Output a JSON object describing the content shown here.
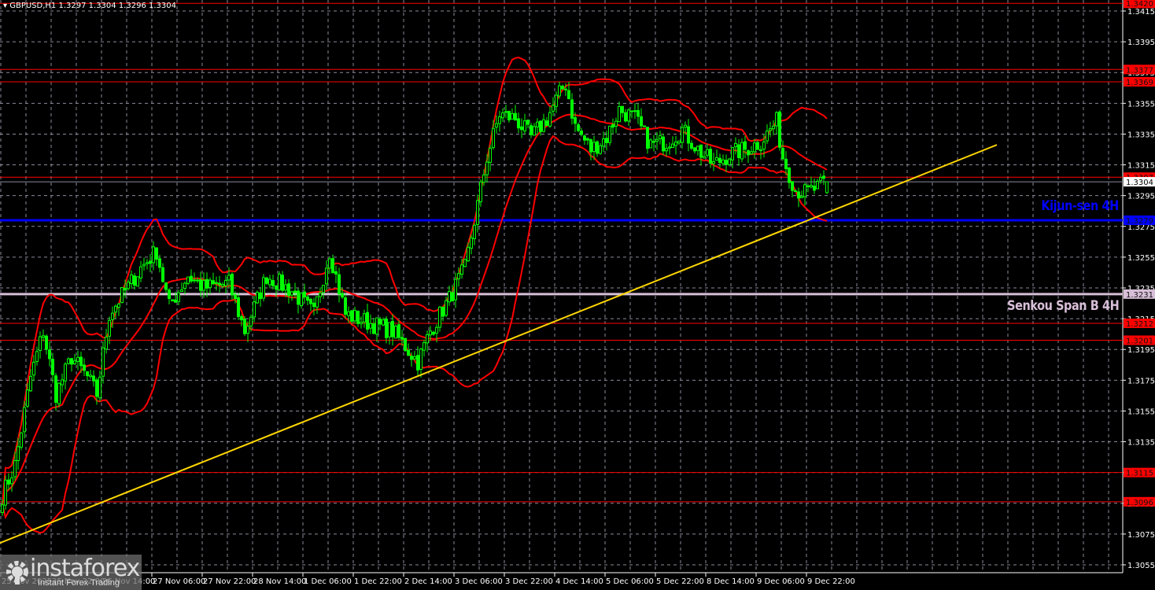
{
  "header": {
    "symbol": "GBPUSD,H1",
    "ohlc": "1.3297 1.3304 1.3296 1.3304"
  },
  "watermark": {
    "brand": "instaforex",
    "tagline": "Instant Forex Trading"
  },
  "annotations": {
    "kijun": "Kijun-sen 4H",
    "senkou": "Senkou Span B 4H"
  },
  "colors": {
    "bg": "#000000",
    "candle": "#00ff00",
    "bands": "#ff0000",
    "level": "#ff0000",
    "kijun": "#0000ff",
    "senkou": "#d8bfd8",
    "trend": "#ffd700",
    "grid": "#8a8a9a"
  },
  "chart_data": {
    "type": "candlestick",
    "title": "GBPUSD,H1",
    "ylim": [
      1.3043,
      1.3423
    ],
    "y_ticks": [
      "1.3415",
      "1.3395",
      "1.3375",
      "1.3355",
      "1.3335",
      "1.3315",
      "1.3295",
      "1.3275",
      "1.3255",
      "1.3235",
      "1.3215",
      "1.3195",
      "1.3175",
      "1.3155",
      "1.3135",
      "1.3115",
      "1.3095",
      "1.3075",
      "1.3055"
    ],
    "x_labels": [
      "25 Nov 2025",
      "25 Nov 22:00",
      "26 Nov 14:00",
      "27 Nov 06:00",
      "27 Nov 22:00",
      "28 Nov 14:00",
      "1 Dec 06:00",
      "1 Dec 22:00",
      "2 Dec 14:00",
      "3 Dec 06:00",
      "3 Dec 22:00",
      "4 Dec 14:00",
      "5 Dec 06:00",
      "5 Dec 22:00",
      "8 Dec 14:00",
      "9 Dec 06:00",
      "9 Dec 22:00"
    ],
    "bars_per_label": 16,
    "close_keypoints": [
      [
        0,
        1.31
      ],
      [
        4,
        1.312
      ],
      [
        9,
        1.3177
      ],
      [
        13,
        1.3207
      ],
      [
        17,
        1.3166
      ],
      [
        22,
        1.319
      ],
      [
        27,
        1.3177
      ],
      [
        30,
        1.3166
      ],
      [
        34,
        1.3218
      ],
      [
        39,
        1.3233
      ],
      [
        44,
        1.3248
      ],
      [
        49,
        1.3259
      ],
      [
        53,
        1.3223
      ],
      [
        59,
        1.3243
      ],
      [
        64,
        1.3235
      ],
      [
        72,
        1.3238
      ],
      [
        77,
        1.3207
      ],
      [
        84,
        1.3243
      ],
      [
        92,
        1.3233
      ],
      [
        99,
        1.3218
      ],
      [
        104,
        1.3259
      ],
      [
        109,
        1.3218
      ],
      [
        117,
        1.3212
      ],
      [
        124,
        1.3207
      ],
      [
        132,
        1.3187
      ],
      [
        136,
        1.3207
      ],
      [
        142,
        1.3228
      ],
      [
        147,
        1.3248
      ],
      [
        151,
        1.3289
      ],
      [
        154,
        1.332
      ],
      [
        158,
        1.3348
      ],
      [
        163,
        1.3345
      ],
      [
        168,
        1.3333
      ],
      [
        173,
        1.3345
      ],
      [
        177,
        1.3361
      ],
      [
        179,
        1.3368
      ],
      [
        182,
        1.334
      ],
      [
        187,
        1.3325
      ],
      [
        192,
        1.3333
      ],
      [
        196,
        1.3351
      ],
      [
        201,
        1.3345
      ],
      [
        206,
        1.3328
      ],
      [
        211,
        1.333
      ],
      [
        216,
        1.3338
      ],
      [
        221,
        1.3325
      ],
      [
        226,
        1.3315
      ],
      [
        231,
        1.3322
      ],
      [
        236,
        1.3325
      ],
      [
        241,
        1.333
      ],
      [
        246,
        1.3343
      ],
      [
        248,
        1.332
      ],
      [
        252,
        1.3299
      ],
      [
        255,
        1.3297
      ],
      [
        259,
        1.33
      ],
      [
        262,
        1.3304
      ]
    ],
    "last_bar": {
      "open": 1.3297,
      "high": 1.3304,
      "low": 1.3296,
      "close": 1.3304
    },
    "bollinger": {
      "period": 20,
      "deviation": 2
    },
    "trend_line": {
      "from": [
        -1,
        1.3069
      ],
      "to": [
        316,
        1.3328
      ]
    },
    "levels": [
      {
        "price": 1.342,
        "label": "1.3420",
        "kind": "resistance"
      },
      {
        "price": 1.3377,
        "label": "1.3377",
        "kind": "resistance"
      },
      {
        "price": 1.3369,
        "label": "1.3369",
        "kind": "resistance"
      },
      {
        "price": 1.3307,
        "label": "1.3307",
        "kind": "resistance"
      },
      {
        "price": 1.3279,
        "label": "1.3279",
        "kind": "kijun"
      },
      {
        "price": 1.3231,
        "label": "1.3231",
        "kind": "senkou"
      },
      {
        "price": 1.3212,
        "label": "1.3212",
        "kind": "support"
      },
      {
        "price": 1.3201,
        "label": "1.3201",
        "kind": "support"
      },
      {
        "price": 1.3115,
        "label": "1.3115",
        "kind": "support"
      },
      {
        "price": 1.3096,
        "label": "1.3096",
        "kind": "support"
      }
    ],
    "current_price": {
      "price": 1.3304,
      "label": "1.3304"
    }
  }
}
